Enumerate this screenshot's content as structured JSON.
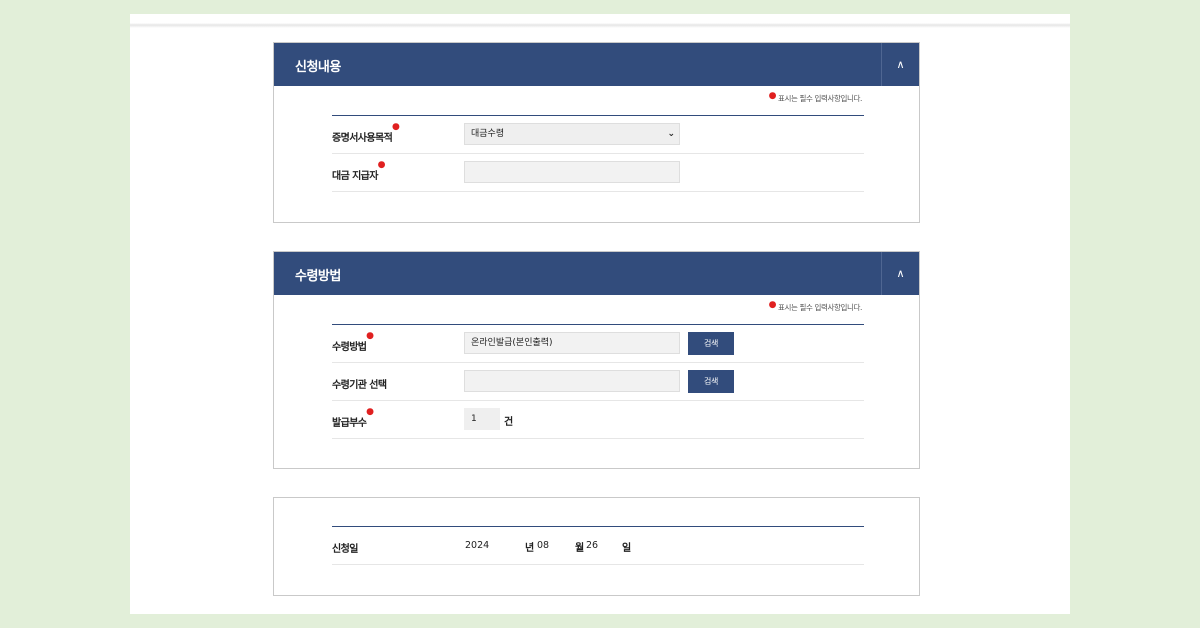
{
  "required_note": "표시는 필수 입력사항입니다.",
  "section1": {
    "title": "신청내용",
    "toggle_icon": "chevron-up-icon",
    "purpose_label": "증명서사용목적",
    "purpose_value": "대금수령",
    "payer_label": "대금 지급자",
    "payer_value": ""
  },
  "section2": {
    "title": "수령방법",
    "toggle_icon": "chevron-up-icon",
    "method_label": "수령방법",
    "method_value": "온라인발급(본인출력)",
    "agency_label": "수령기관 선택",
    "agency_value": "",
    "search_label": "검색",
    "copies_label": "발급부수",
    "copies_value": "1",
    "copies_unit": "건"
  },
  "section3": {
    "date_label": "신청일",
    "year": "2024",
    "year_unit": "년",
    "month": "08",
    "month_unit": "월",
    "day": "26",
    "day_unit": "일"
  },
  "colors": {
    "header_bg": "#324c7c",
    "page_bg": "#e2efd9",
    "required": "#e02020"
  }
}
